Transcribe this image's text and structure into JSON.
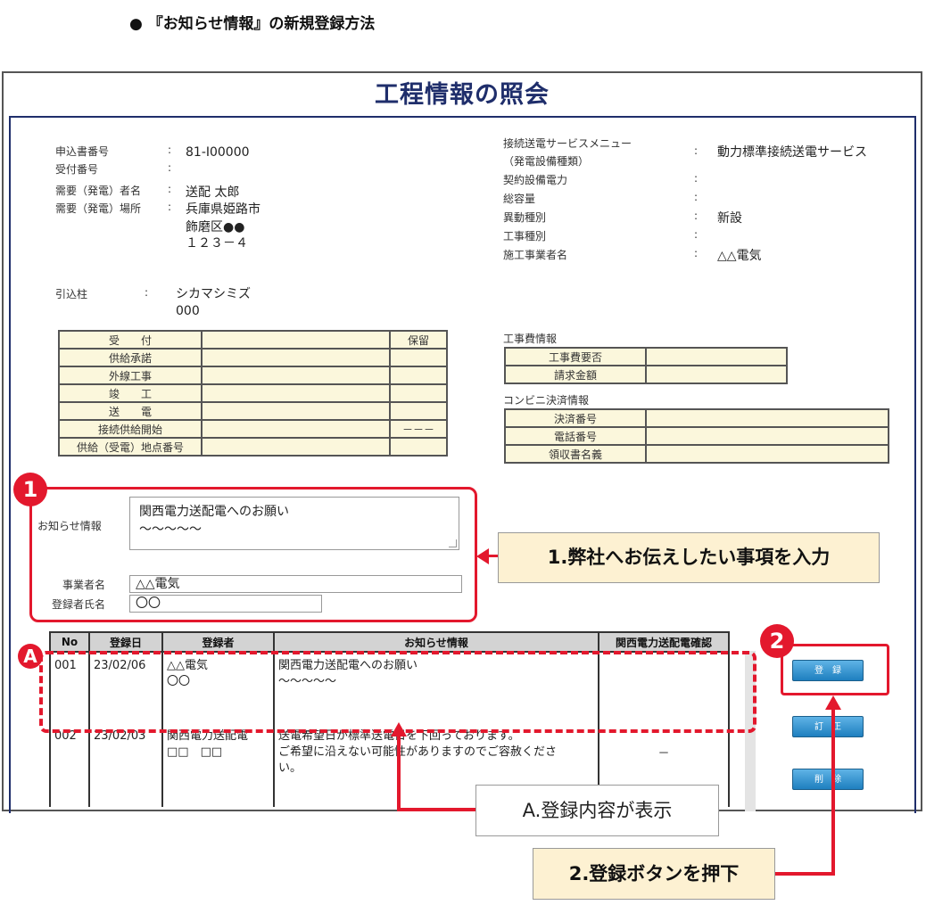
{
  "heading": "● 『お知らせ情報』の新規登録方法",
  "page_title": "工程情報の照会",
  "applicant": {
    "rows": [
      {
        "label": "申込書番号",
        "colon": ":",
        "value": "81-I00000"
      },
      {
        "label": "受付番号",
        "colon": ":",
        "value": ""
      },
      {
        "label": "需要（発電）者名",
        "colon": ":",
        "value": "送配 太郎"
      },
      {
        "label": "需要（発電）場所",
        "colon": ":",
        "value": "兵庫県姫路市"
      }
    ],
    "address_line2": "飾磨区●●",
    "address_line3": "１２３－４",
    "pole_label": "引込柱",
    "pole_colon": ":",
    "pole_value1": "シカマシミズ",
    "pole_value2": "000"
  },
  "service": {
    "rows": [
      {
        "label": "接続送電サービスメニュー",
        "colon": ":",
        "value": "動力標準接続送電サービス"
      },
      {
        "label": "（発電設備種類）",
        "colon": "",
        "value": ""
      },
      {
        "label": "契約設備電力",
        "colon": ":",
        "value": ""
      },
      {
        "label": "総容量",
        "colon": ":",
        "value": ""
      },
      {
        "label": "異動種別",
        "colon": ":",
        "value": "新設"
      },
      {
        "label": "工事種別",
        "colon": ":",
        "value": ""
      },
      {
        "label": "施工事業者名",
        "colon": ":",
        "value": "△△電気"
      }
    ]
  },
  "progress_table": {
    "header_left": "受　　付",
    "header_right": "保留",
    "rows": [
      {
        "label": "供給承諾",
        "right": ""
      },
      {
        "label": "外線工事",
        "right": ""
      },
      {
        "label": "竣　　工",
        "right": ""
      },
      {
        "label": "送　　電",
        "right": ""
      },
      {
        "label": "接続供給開始",
        "right": "－－－"
      },
      {
        "label": "供給（受電）地点番号",
        "right": ""
      }
    ]
  },
  "cost_info": {
    "title": "工事費情報",
    "rows": [
      {
        "label": "工事費要否"
      },
      {
        "label": "請求金額"
      }
    ]
  },
  "conveni_info": {
    "title": "コンビニ決済情報",
    "rows": [
      {
        "label": "決済番号"
      },
      {
        "label": "電話番号"
      },
      {
        "label": "領収書名義"
      }
    ]
  },
  "notice_form": {
    "label": "お知らせ情報",
    "text_line1": "関西電力送配電へのお願い",
    "text_line2": "～～～～～",
    "company_label": "事業者名",
    "company_value": "△△電気",
    "registrant_label": "登録者氏名",
    "registrant_value": "〇〇"
  },
  "badges": {
    "one": "1",
    "two": "2",
    "a": "A"
  },
  "callouts": {
    "step1": "1.弊社へお伝えしたい事項を入力",
    "stepA": "A.登録内容が表示",
    "step2": "2.登録ボタンを押下"
  },
  "list": {
    "headers": [
      "No",
      "登録日",
      "登録者",
      "お知らせ情報",
      "関西電力送配電確認"
    ],
    "rows": [
      {
        "no": "001",
        "date": "23/02/06",
        "who1": "△△電気",
        "who2": "〇〇",
        "info1": "関西電力送配電へのお願い",
        "info2": "～～～～～",
        "info3": "",
        "confirm": ""
      },
      {
        "no": "002",
        "date": "23/02/03",
        "who1": "関西電力送配電",
        "who2": "□□　□□",
        "info1": "送電希望日が標準送電日を下回っております。",
        "info2": "ご希望に沿えない可能性がありますのでご容赦くださ",
        "info3": "い。",
        "confirm": "－"
      }
    ]
  },
  "buttons": {
    "register": "登　録",
    "edit": "訂　正",
    "delete": "削　除"
  },
  "colors": {
    "accent_red": "#e3182d",
    "title_navy": "#1f2e6b",
    "cell_cream": "#fbf7dc",
    "callout_cream": "#fdf1d2",
    "button_blue": "#2a8fd0"
  }
}
